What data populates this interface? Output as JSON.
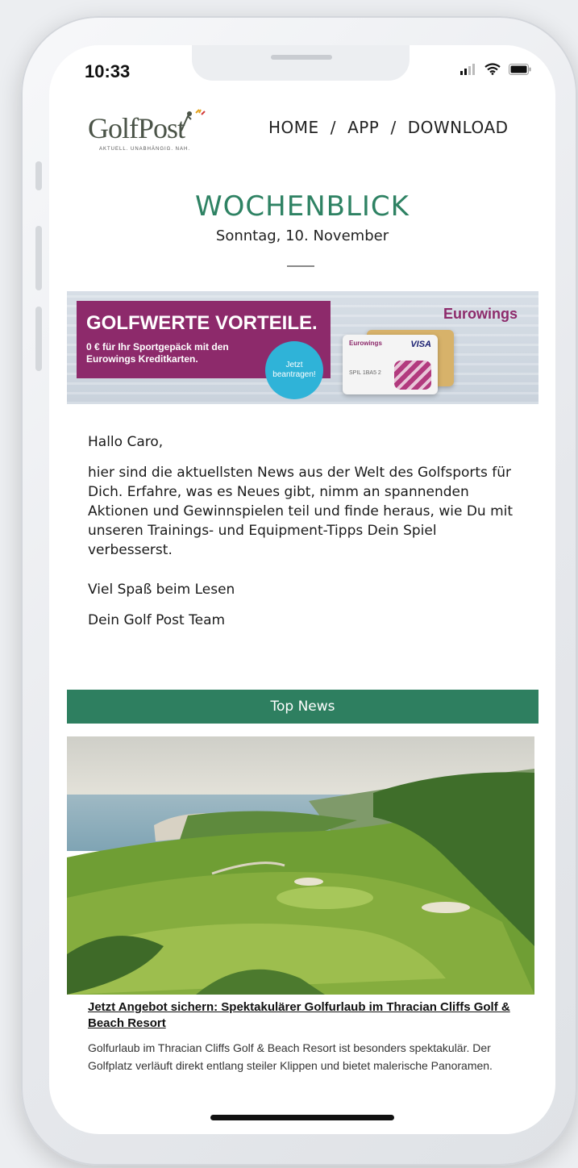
{
  "status_bar": {
    "time": "10:33"
  },
  "header": {
    "logo_text": "GolfPost",
    "logo_tagline": "AKTUELL. UNABHÄNGIG. NAH.",
    "nav": {
      "home": "HOME",
      "app": "APP",
      "download": "DOWNLOAD",
      "separator": "/"
    }
  },
  "newsletter": {
    "title": "WOCHENBLICK",
    "date": "Sonntag, 10. November"
  },
  "banner": {
    "headline": "GOLFWERTE VORTEILE.",
    "subline": "0 € für Ihr Sportgepäck mit den Eurowings Kreditkarten.",
    "cta": "Jetzt beantragen!",
    "brand": "Eurowings",
    "card_brand": "Eurowings",
    "card_network": "VISA",
    "card_number": "SPIL 1BA5 2"
  },
  "intro": {
    "greeting": "Hallo Caro,",
    "paragraph": "hier sind die aktuellsten News aus der Welt des Golfsports für Dich. Erfahre, was es Neues gibt, nimm an spannenden Aktionen und Gewinnspielen teil und finde heraus, wie Du mit unseren Trainings- und Equipment-Tipps Dein Spiel verbesserst.",
    "regards": "Viel Spaß beim Lesen",
    "team": "Dein Golf Post Team"
  },
  "section": {
    "title": "Top News"
  },
  "article": {
    "headline": "Jetzt Angebot sichern: Spektakulärer Golfurlaub im Thracian Cliffs Golf & Beach Resort",
    "summary": "Golfurlaub im Thracian Cliffs Golf & Beach Resort ist besonders spektakulär. Der Golfplatz verläuft direkt entlang steiler Klippen und bietet malerische Panoramen."
  },
  "colors": {
    "brand_green": "#2e8263",
    "section_bar": "#2e7f60",
    "banner_purple": "#8d2a6b",
    "cta_blue": "#2fb3d8"
  },
  "icons": [
    "signal-icon",
    "wifi-icon",
    "battery-icon",
    "golfer-logo-icon"
  ]
}
